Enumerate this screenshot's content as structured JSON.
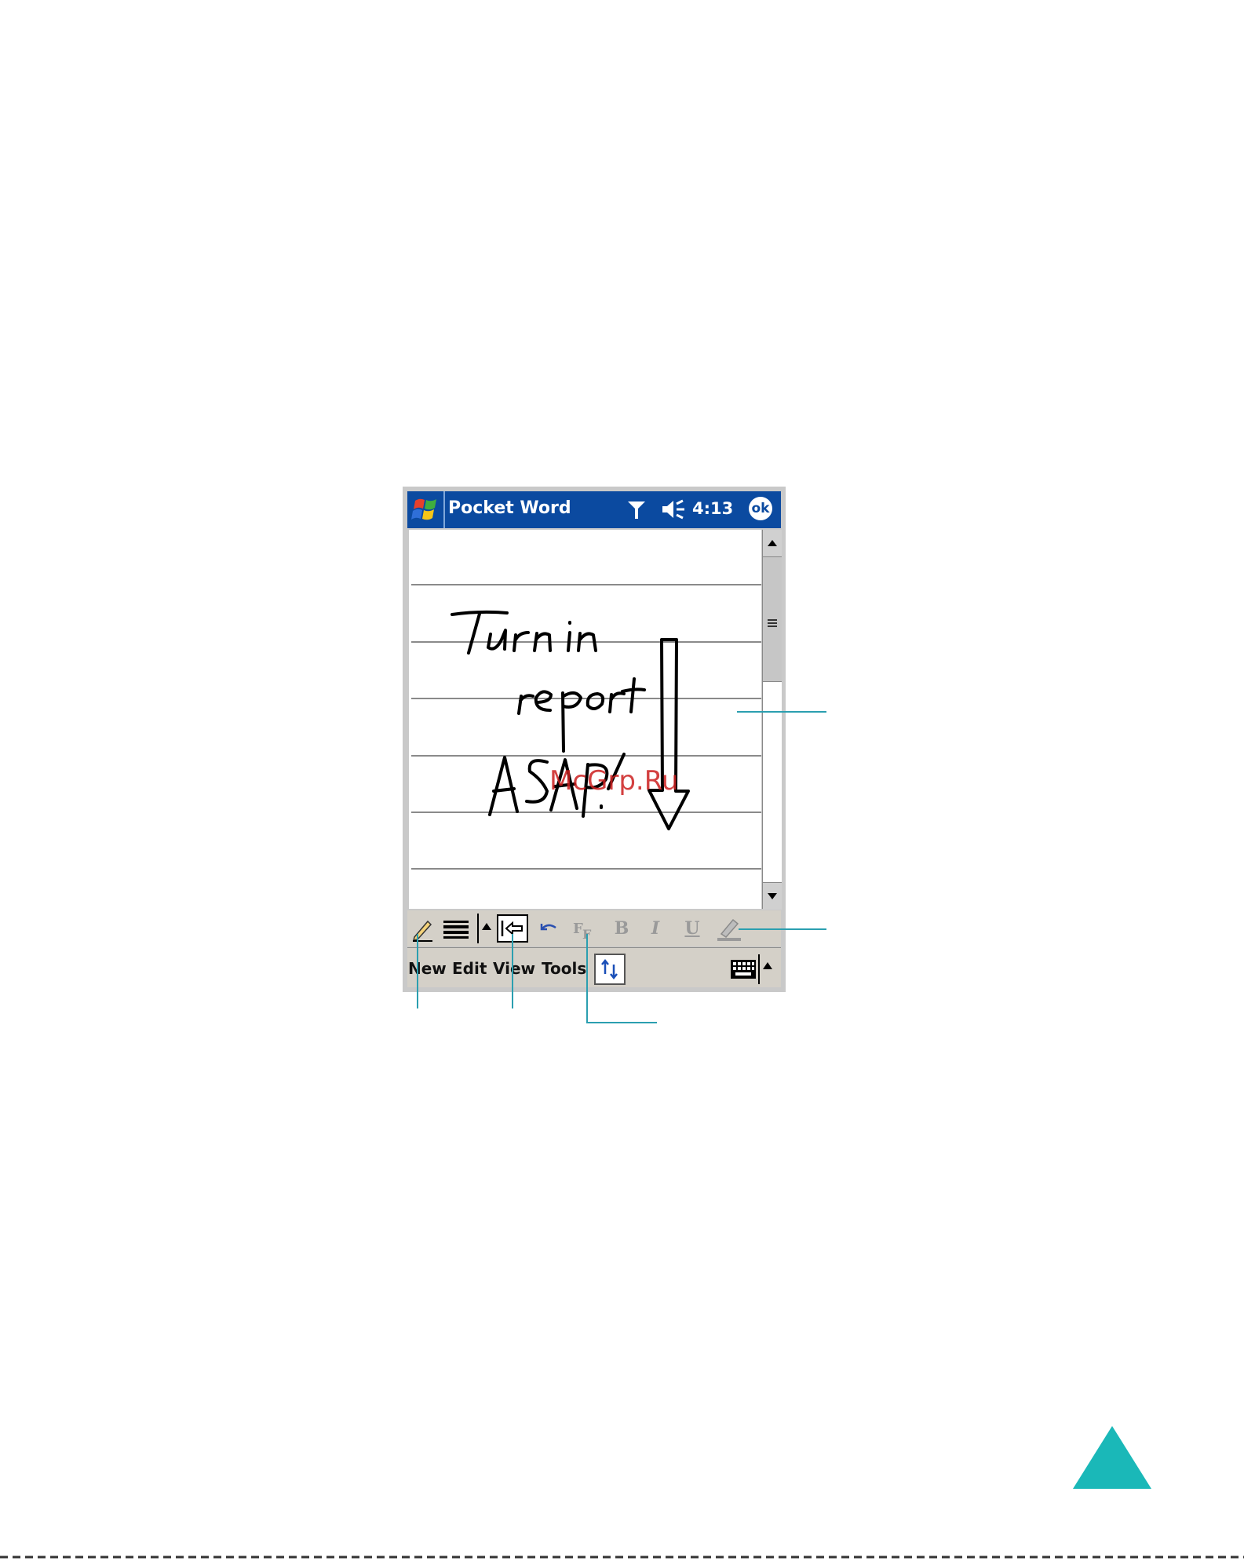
{
  "title_bar": {
    "app_title": "Pocket Word",
    "time": "4:13",
    "ok_label": "ok",
    "icons": [
      "windows-start-icon",
      "signal-antenna-icon",
      "speaker-volume-icon"
    ]
  },
  "document": {
    "handwriting_lines": [
      "Turn in",
      "report",
      "ASAP!"
    ],
    "drawing": "down-arrow"
  },
  "toolbar": {
    "format_buttons": {
      "bold": "B",
      "italic": "I",
      "underline": "U"
    },
    "icons": [
      "pen-icon",
      "line-width-icon",
      "up-arrow-icon",
      "space-insert-icon",
      "undo-icon",
      "font-icon",
      "highlighter-icon"
    ]
  },
  "menu_bar": {
    "items": [
      "New",
      "Edit",
      "View",
      "Tools"
    ],
    "icons": [
      "toggle-arrows-icon",
      "keyboard-icon",
      "up-arrow-icon"
    ]
  },
  "watermark": "McGrp.Ru",
  "colors": {
    "title_bar": "#0b4aa0",
    "callout_line": "#2b9fb0",
    "nav_triangle": "#1ab8b8",
    "watermark": "#cc1f1f"
  }
}
